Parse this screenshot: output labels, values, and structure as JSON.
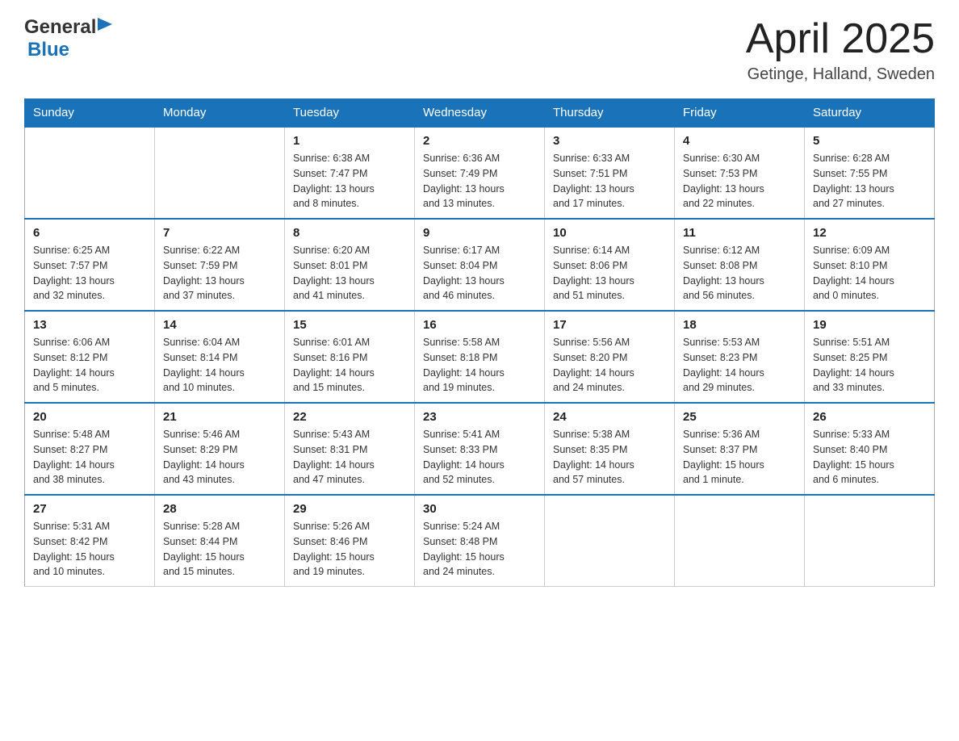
{
  "header": {
    "logo": {
      "text_general": "General",
      "text_blue": "Blue",
      "alt": "GeneralBlue logo"
    },
    "title": "April 2025",
    "location": "Getinge, Halland, Sweden"
  },
  "calendar": {
    "weekdays": [
      "Sunday",
      "Monday",
      "Tuesday",
      "Wednesday",
      "Thursday",
      "Friday",
      "Saturday"
    ],
    "weeks": [
      [
        {
          "day": "",
          "info": ""
        },
        {
          "day": "",
          "info": ""
        },
        {
          "day": "1",
          "info": "Sunrise: 6:38 AM\nSunset: 7:47 PM\nDaylight: 13 hours\nand 8 minutes."
        },
        {
          "day": "2",
          "info": "Sunrise: 6:36 AM\nSunset: 7:49 PM\nDaylight: 13 hours\nand 13 minutes."
        },
        {
          "day": "3",
          "info": "Sunrise: 6:33 AM\nSunset: 7:51 PM\nDaylight: 13 hours\nand 17 minutes."
        },
        {
          "day": "4",
          "info": "Sunrise: 6:30 AM\nSunset: 7:53 PM\nDaylight: 13 hours\nand 22 minutes."
        },
        {
          "day": "5",
          "info": "Sunrise: 6:28 AM\nSunset: 7:55 PM\nDaylight: 13 hours\nand 27 minutes."
        }
      ],
      [
        {
          "day": "6",
          "info": "Sunrise: 6:25 AM\nSunset: 7:57 PM\nDaylight: 13 hours\nand 32 minutes."
        },
        {
          "day": "7",
          "info": "Sunrise: 6:22 AM\nSunset: 7:59 PM\nDaylight: 13 hours\nand 37 minutes."
        },
        {
          "day": "8",
          "info": "Sunrise: 6:20 AM\nSunset: 8:01 PM\nDaylight: 13 hours\nand 41 minutes."
        },
        {
          "day": "9",
          "info": "Sunrise: 6:17 AM\nSunset: 8:04 PM\nDaylight: 13 hours\nand 46 minutes."
        },
        {
          "day": "10",
          "info": "Sunrise: 6:14 AM\nSunset: 8:06 PM\nDaylight: 13 hours\nand 51 minutes."
        },
        {
          "day": "11",
          "info": "Sunrise: 6:12 AM\nSunset: 8:08 PM\nDaylight: 13 hours\nand 56 minutes."
        },
        {
          "day": "12",
          "info": "Sunrise: 6:09 AM\nSunset: 8:10 PM\nDaylight: 14 hours\nand 0 minutes."
        }
      ],
      [
        {
          "day": "13",
          "info": "Sunrise: 6:06 AM\nSunset: 8:12 PM\nDaylight: 14 hours\nand 5 minutes."
        },
        {
          "day": "14",
          "info": "Sunrise: 6:04 AM\nSunset: 8:14 PM\nDaylight: 14 hours\nand 10 minutes."
        },
        {
          "day": "15",
          "info": "Sunrise: 6:01 AM\nSunset: 8:16 PM\nDaylight: 14 hours\nand 15 minutes."
        },
        {
          "day": "16",
          "info": "Sunrise: 5:58 AM\nSunset: 8:18 PM\nDaylight: 14 hours\nand 19 minutes."
        },
        {
          "day": "17",
          "info": "Sunrise: 5:56 AM\nSunset: 8:20 PM\nDaylight: 14 hours\nand 24 minutes."
        },
        {
          "day": "18",
          "info": "Sunrise: 5:53 AM\nSunset: 8:23 PM\nDaylight: 14 hours\nand 29 minutes."
        },
        {
          "day": "19",
          "info": "Sunrise: 5:51 AM\nSunset: 8:25 PM\nDaylight: 14 hours\nand 33 minutes."
        }
      ],
      [
        {
          "day": "20",
          "info": "Sunrise: 5:48 AM\nSunset: 8:27 PM\nDaylight: 14 hours\nand 38 minutes."
        },
        {
          "day": "21",
          "info": "Sunrise: 5:46 AM\nSunset: 8:29 PM\nDaylight: 14 hours\nand 43 minutes."
        },
        {
          "day": "22",
          "info": "Sunrise: 5:43 AM\nSunset: 8:31 PM\nDaylight: 14 hours\nand 47 minutes."
        },
        {
          "day": "23",
          "info": "Sunrise: 5:41 AM\nSunset: 8:33 PM\nDaylight: 14 hours\nand 52 minutes."
        },
        {
          "day": "24",
          "info": "Sunrise: 5:38 AM\nSunset: 8:35 PM\nDaylight: 14 hours\nand 57 minutes."
        },
        {
          "day": "25",
          "info": "Sunrise: 5:36 AM\nSunset: 8:37 PM\nDaylight: 15 hours\nand 1 minute."
        },
        {
          "day": "26",
          "info": "Sunrise: 5:33 AM\nSunset: 8:40 PM\nDaylight: 15 hours\nand 6 minutes."
        }
      ],
      [
        {
          "day": "27",
          "info": "Sunrise: 5:31 AM\nSunset: 8:42 PM\nDaylight: 15 hours\nand 10 minutes."
        },
        {
          "day": "28",
          "info": "Sunrise: 5:28 AM\nSunset: 8:44 PM\nDaylight: 15 hours\nand 15 minutes."
        },
        {
          "day": "29",
          "info": "Sunrise: 5:26 AM\nSunset: 8:46 PM\nDaylight: 15 hours\nand 19 minutes."
        },
        {
          "day": "30",
          "info": "Sunrise: 5:24 AM\nSunset: 8:48 PM\nDaylight: 15 hours\nand 24 minutes."
        },
        {
          "day": "",
          "info": ""
        },
        {
          "day": "",
          "info": ""
        },
        {
          "day": "",
          "info": ""
        }
      ]
    ]
  }
}
